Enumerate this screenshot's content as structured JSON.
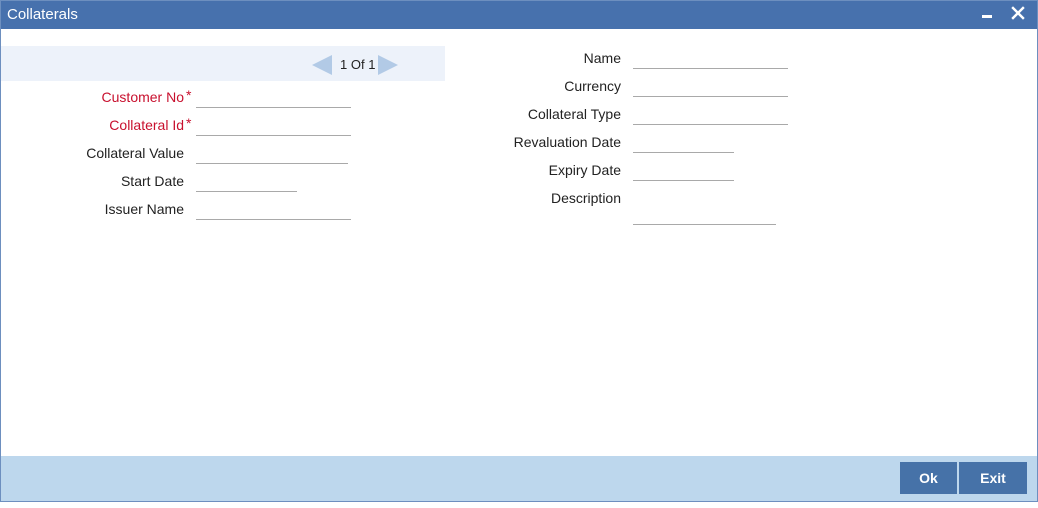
{
  "window": {
    "title": "Collaterals",
    "minimize_icon": "minimize-icon",
    "close_icon": "close-icon"
  },
  "pager": {
    "current": "1",
    "separator": "Of",
    "total": "1",
    "prev_icon": "arrow-left-icon",
    "next_icon": "arrow-right-icon"
  },
  "left_form": {
    "customer_no": {
      "label": "Customer No",
      "required": "*",
      "value": ""
    },
    "collateral_id": {
      "label": "Collateral Id",
      "required": "*",
      "value": ""
    },
    "collateral_value": {
      "label": "Collateral Value",
      "value": ""
    },
    "start_date": {
      "label": "Start Date",
      "value": ""
    },
    "issuer_name": {
      "label": "Issuer Name",
      "value": ""
    }
  },
  "right_form": {
    "name": {
      "label": "Name",
      "value": ""
    },
    "currency": {
      "label": "Currency",
      "value": ""
    },
    "collateral_type": {
      "label": "Collateral Type",
      "value": ""
    },
    "revaluation_date": {
      "label": "Revaluation Date",
      "value": ""
    },
    "expiry_date": {
      "label": "Expiry Date",
      "value": ""
    },
    "description": {
      "label": "Description",
      "value": ""
    }
  },
  "footer": {
    "ok_label": "Ok",
    "exit_label": "Exit"
  },
  "colors": {
    "titlebar": "#4771ad",
    "required_label": "#c8102e",
    "footer": "#bdd7ed",
    "button": "#4672a8",
    "pager_band": "#edf2fa"
  }
}
